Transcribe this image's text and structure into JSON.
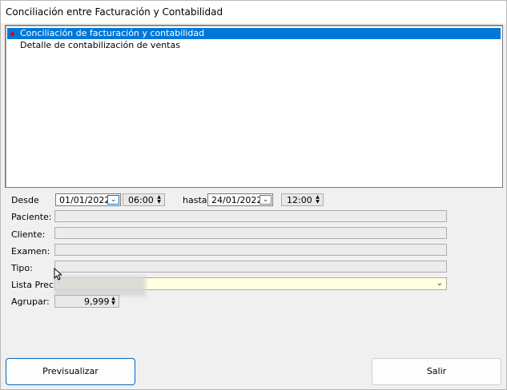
{
  "window": {
    "title": "Conciliación entre Facturación y Contabilidad"
  },
  "list": {
    "items": [
      {
        "label": "Conciliación de facturación y contabilidad",
        "selected": true
      },
      {
        "label": "Detalle de contabilización de ventas",
        "selected": false
      }
    ]
  },
  "filters": {
    "desde_label": "Desde",
    "desde_date": "01/01/2022",
    "desde_time": "06:00",
    "hasta_label": "hasta",
    "hasta_date": "24/01/2022",
    "hasta_time": "12:00",
    "paciente_label": "Paciente:",
    "paciente_value": "",
    "cliente_label": "Cliente:",
    "cliente_value": "",
    "examen_label": "Examen:",
    "examen_value": "",
    "tipo_label": "Tipo:",
    "tipo_value": "",
    "lista_prec_label": "Lista Prec:",
    "lista_prec_value": "",
    "agrupar_label": "Agrupar:",
    "agrupar_value": "9,999"
  },
  "buttons": {
    "previsualizar": "Previsualizar",
    "salir": "Salir"
  },
  "colors": {
    "selection": "#0078d7",
    "bullet": "#e0001b",
    "combo_bg": "#ffffe1"
  },
  "icons": {
    "dropdown": "chevron-down-icon",
    "spinner": "spin-arrows-icon",
    "cursor": "mouse-pointer-icon"
  }
}
